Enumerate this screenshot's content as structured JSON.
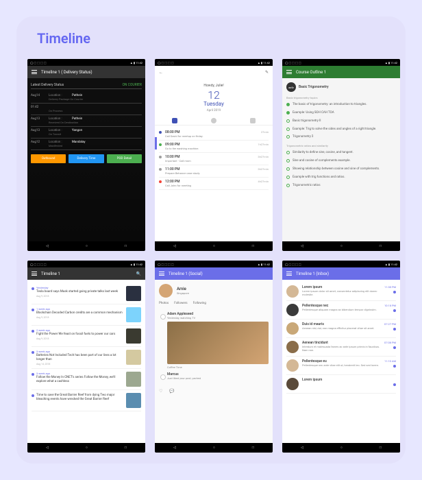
{
  "section_title": "Timeline",
  "status": {
    "left": "◯ ⬚ ⬚ ⬚ ⬚",
    "right": "▲ ▮ 11:42"
  },
  "screens": [
    {
      "title": "Timeline 1 ( Delivery Status)",
      "latest_label": "Latest Delivery Status",
      "latest_value": "ON COURIER",
      "loc_label": "Location :",
      "rows": [
        {
          "date": "Aug14",
          "city": "Pathein",
          "sub": "Delivery Package On Courier"
        },
        {
          "date": "01:42",
          "city": "",
          "sub": "On Process"
        },
        {
          "date": "Aug13",
          "city": "Pathein",
          "sub": "Received On Destination"
        },
        {
          "date": "Aug13",
          "city": "Yangon",
          "sub": "On Transit"
        },
        {
          "date": "Aug12",
          "city": "Mandalay",
          "sub": "Manifested"
        }
      ],
      "buttons": [
        "Outbound",
        "Delivery Time",
        "POD Detail"
      ]
    },
    {
      "greeting": "Howdy, Julie!",
      "day_num": "12",
      "day_name": "Tuesday",
      "month": "April 2019",
      "events": [
        {
          "time": "08:00 PM",
          "desc": "Call David for meetup on friday.",
          "dur": "27min"
        },
        {
          "time": "09:00 PM",
          "desc": "Go to the washing machine.",
          "dur": "1h27min"
        },
        {
          "time": "10:00 PM",
          "desc": "Important - Call mom",
          "dur": "3h27min"
        },
        {
          "time": "11:00 PM",
          "desc": "Prepare Behance case study.",
          "dur": "3h27min"
        },
        {
          "time": "12:00 PM",
          "desc": "Call John for meeting",
          "dur": "4h27min"
        }
      ]
    },
    {
      "title": "Course Outline 1",
      "course": "Basic Trigonometry",
      "sections": [
        {
          "name": "Basic trigonometry topics",
          "items": [
            "The basic of trigonometry: an introduction to triangles.",
            "Example: Using SOH CAH TOA",
            "Basic trigonometry II",
            "Example: Trig to solve the sides and angles of a right triangle.",
            "Trigonometry 2"
          ]
        },
        {
          "name": "Trigonometric ratios and similarity",
          "items": [
            "Similarity to define sine, cosine, and tangent.",
            "Sine and cosine of complements example.",
            "Showing relationship between cosine and sine of complements.",
            "Example with trig functions and ratios.",
            "Trigonometric ratios"
          ]
        }
      ]
    },
    {
      "title": "Timeline 1",
      "posts": [
        {
          "when": "Yesterday",
          "headline": "Tesla board says Musk started going private talks last week",
          "date": "Aug 9, 2018"
        },
        {
          "when": "1 week ago",
          "headline": "Blockchain Decoded Carbon credits are a common mechanism",
          "date": "Aug 9, 2018"
        },
        {
          "when": "2 week ago",
          "headline": "Fight the Power We feast on fossil fuels to power our cars",
          "date": "Aug 9, 2018"
        },
        {
          "when": "3 week ago",
          "headline": "Batteries Not Included Tech has been part of our lives a lot longer than",
          "date": "Aug 14, 2018"
        },
        {
          "when": "3 week ago",
          "headline": "Follow the Money In CNET's series Follow the Money, we'll explore what a cashless",
          "date": ""
        },
        {
          "when": "",
          "headline": "Time to save the Great Barrier Reef from dying Two major bleaching events have wrecked the Great Barrier Reef",
          "date": ""
        }
      ]
    },
    {
      "title": "Timeline 1 (Social)",
      "profile": {
        "name": "Amie",
        "location": "Singapore"
      },
      "tabs": [
        "Photos",
        "Followers",
        "Following"
      ],
      "feed": [
        {
          "name": "Adam Appleseed",
          "sub": "Yesterday, watching TV",
          "caption": "Coffee Time"
        },
        {
          "name": "Marcus",
          "sub": "Just liked your post, yached"
        }
      ]
    },
    {
      "title": "Timeline 1 (Inbox)",
      "messages": [
        {
          "title": "Lorem ipsum",
          "text": "Lorem ipsum dolor sit amet, consectetur adipiscing elit donec molestie.",
          "time": "11:30 PM"
        },
        {
          "title": "Pellentesque nec",
          "text": "Pellentesque aliquam magna ac bibendum tempor dignissim.",
          "time": "10:18 PM"
        },
        {
          "title": "Duis id mauris",
          "text": "Aenean nisi, dui, non magna efficitur placerat vitae sit amet.",
          "time": "07:27 PM"
        },
        {
          "title": "Aenean tincidunt",
          "text": "Interdum et malesuada fames ac ante ipsum primis in faucibus. Nam non.",
          "time": "07:08 PM"
        },
        {
          "title": "Pellentesque eu",
          "text": "Pellentesque nec ante vitae elit ut, hendrerit leo. Sed sed lorem.",
          "time": "11:10 AM"
        },
        {
          "title": "Lorem ipsum",
          "text": "",
          "time": ""
        }
      ]
    }
  ]
}
